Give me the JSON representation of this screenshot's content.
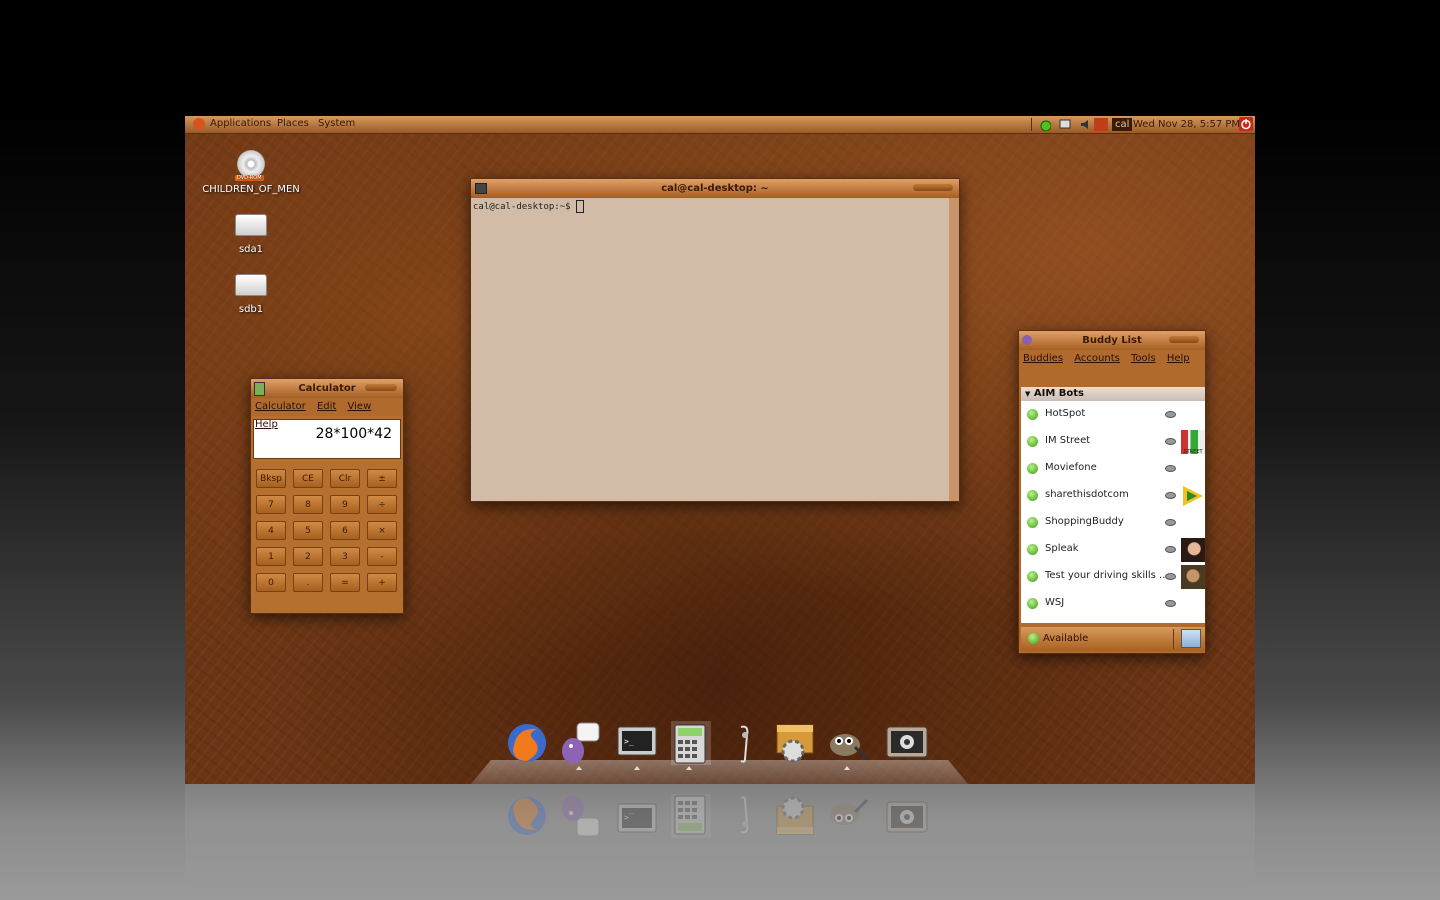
{
  "panel": {
    "menus": [
      "Applications",
      "Places",
      "System"
    ],
    "user": "cal",
    "clock": "Wed Nov 28,  5:57 PM"
  },
  "desktop_icons": [
    {
      "label": "CHILDREN_OF_MEN",
      "badge": "DVD-ROM",
      "icon": "dvd-icon"
    },
    {
      "label": "sda1",
      "icon": "drive-icon"
    },
    {
      "label": "sdb1",
      "icon": "drive-icon"
    }
  ],
  "terminal": {
    "title": "cal@cal-desktop: ~",
    "prompt": "cal@cal-desktop:~$ "
  },
  "calculator": {
    "title": "Calculator",
    "menu": [
      "Calculator",
      "Edit",
      "View",
      "Help"
    ],
    "display": "28*100*42",
    "keys": [
      [
        "Bksp",
        "CE",
        "Clr",
        "±"
      ],
      [
        "7",
        "8",
        "9",
        "÷"
      ],
      [
        "4",
        "5",
        "6",
        "×"
      ],
      [
        "1",
        "2",
        "3",
        "-"
      ],
      [
        "0",
        ".",
        "=",
        "+"
      ]
    ]
  },
  "buddy_list": {
    "title": "Buddy List",
    "menu": [
      "Buddies",
      "Accounts",
      "Tools",
      "Help"
    ],
    "group": "AIM Bots",
    "buddies": [
      "HotSpot",
      "IM Street",
      "Moviefone",
      "sharethisdotcom",
      "ShoppingBuddy",
      "Spleak",
      "Test your driving skills ...",
      "WSJ"
    ],
    "im_street_badge": "STREET",
    "status": "Available"
  },
  "dock": {
    "items": [
      "firefox-icon",
      "pidgin-icon",
      "terminal-icon",
      "calculator-icon",
      "audio-icon",
      "package-icon",
      "gimp-icon",
      "screenshot-icon"
    ]
  },
  "colors": {
    "accent": "#b06a2e",
    "status_green": "#3c9a15",
    "desktop": "#6a3514"
  }
}
